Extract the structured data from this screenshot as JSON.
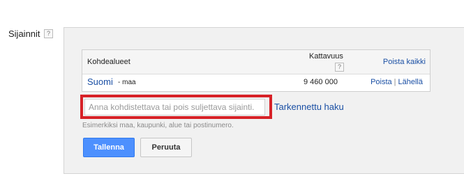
{
  "section": {
    "label": "Sijainnit",
    "help_icon": "?"
  },
  "table": {
    "columns": {
      "areas": "Kohdealueet",
      "reach": "Kattavuus",
      "reach_help_icon": "?",
      "remove_all": "Poista kaikki"
    },
    "rows": [
      {
        "name": "Suomi",
        "type": "- maa",
        "reach": "9 460 000",
        "remove": "Poista",
        "separator": "|",
        "nearby": "Lähellä"
      }
    ]
  },
  "search": {
    "placeholder": "Anna kohdistettava tai pois suljettava sijainti.",
    "value": "",
    "advanced_link": "Tarkennettu haku",
    "hint": "Esimerkiksi maa, kaupunki, alue tai postinumero."
  },
  "actions": {
    "save_label": "Tallenna",
    "cancel_label": "Peruuta"
  },
  "colors": {
    "link": "#1a4fa4",
    "highlight": "#d72127",
    "primary_button": "#4d90fe",
    "panel_bg": "#f1f1f1"
  }
}
